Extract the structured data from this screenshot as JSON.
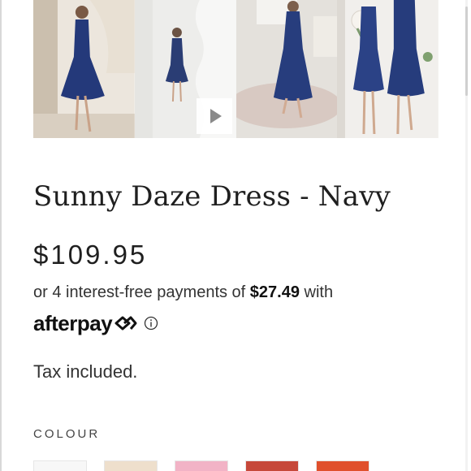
{
  "product": {
    "title": "Sunny Daze Dress - Navy",
    "price": "$109.95"
  },
  "installments": {
    "prefix": "or 4 interest-free payments of ",
    "amount": "$27.49",
    "suffix": " with"
  },
  "afterpay": {
    "wordmark": "afterpay"
  },
  "tax_note": "Tax included.",
  "colour": {
    "label": "COLOUR",
    "swatches": [
      "#f7f7f7",
      "#eedfcc",
      "#f2b3c6",
      "#c6483a",
      "#e0502c"
    ]
  },
  "gallery": {
    "icons": [
      "play-icon"
    ]
  },
  "colors": {
    "navy": "#233a78",
    "text": "#1f1f1f"
  }
}
